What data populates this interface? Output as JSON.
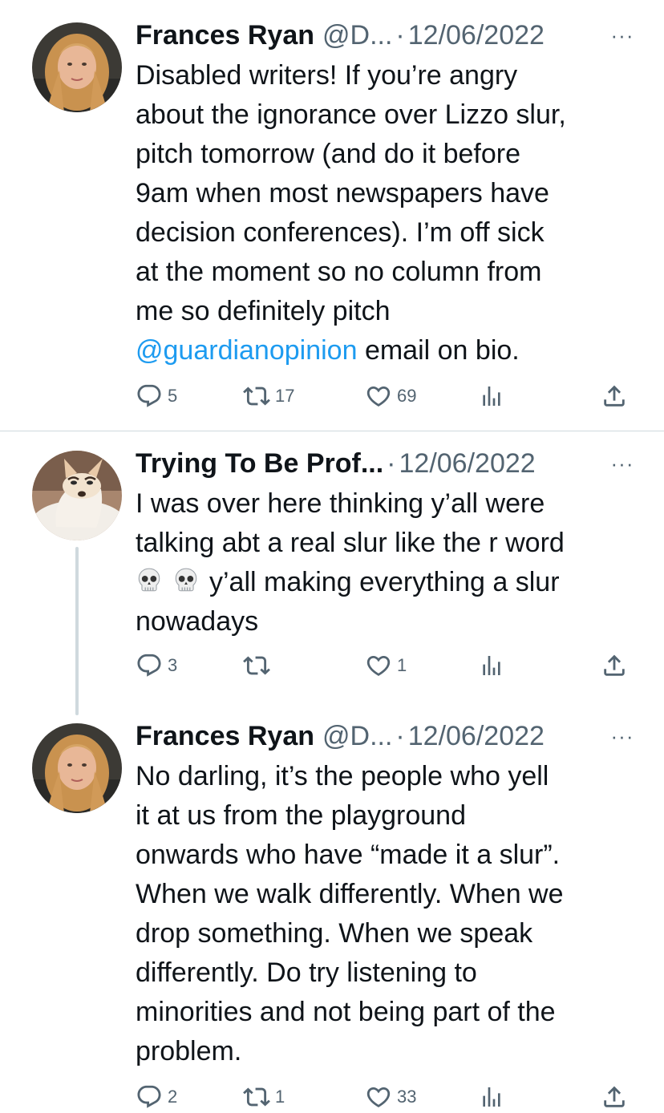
{
  "tweets": [
    {
      "name": "Frances Ryan",
      "handle": "@D...",
      "date": "12/06/2022",
      "more": "···",
      "lines": [
        "Disabled writers! If you’re angry",
        "about the ignorance over Lizzo slur,",
        "pitch tomorrow (and do it before",
        "9am when most newspapers have",
        "decision conferences). I’m off sick",
        "at the moment so no column from",
        "me so definitely pitch"
      ],
      "mention": "@guardianopinion",
      "last_line_rest": " email on bio.",
      "replies": "5",
      "retweets": "17",
      "likes": "69"
    },
    {
      "name": "Trying To Be Prof...",
      "date": "12/06/2022",
      "more": "···",
      "lines": [
        "I was over here thinking y’all were",
        "talking abt a real slur like the r word"
      ],
      "emoji_line_rest": "y’all making everything a slur",
      "emoji_name": "skull-emoji",
      "last_line": "nowadays",
      "replies": "3",
      "retweets": "",
      "likes": "1"
    },
    {
      "name": "Frances Ryan",
      "handle": "@D...",
      "date": "12/06/2022",
      "more": "···",
      "lines": [
        "No darling, it’s the people who yell",
        "it at us from the playground",
        "onwards who have “made it a slur”.",
        "When we walk differently. When we",
        "drop something. When we speak",
        "differently. Do try listening to",
        "minorities and not being part of the",
        "problem."
      ],
      "replies": "2",
      "retweets": "1",
      "likes": "33"
    }
  ],
  "separator": "·",
  "colors": {
    "text": "#0f1419",
    "secondary": "#536471",
    "link": "#1d9bf0",
    "border": "#cfd9de"
  },
  "icons": [
    "reply-icon",
    "retweet-icon",
    "like-icon",
    "views-icon",
    "share-icon",
    "more-icon"
  ]
}
